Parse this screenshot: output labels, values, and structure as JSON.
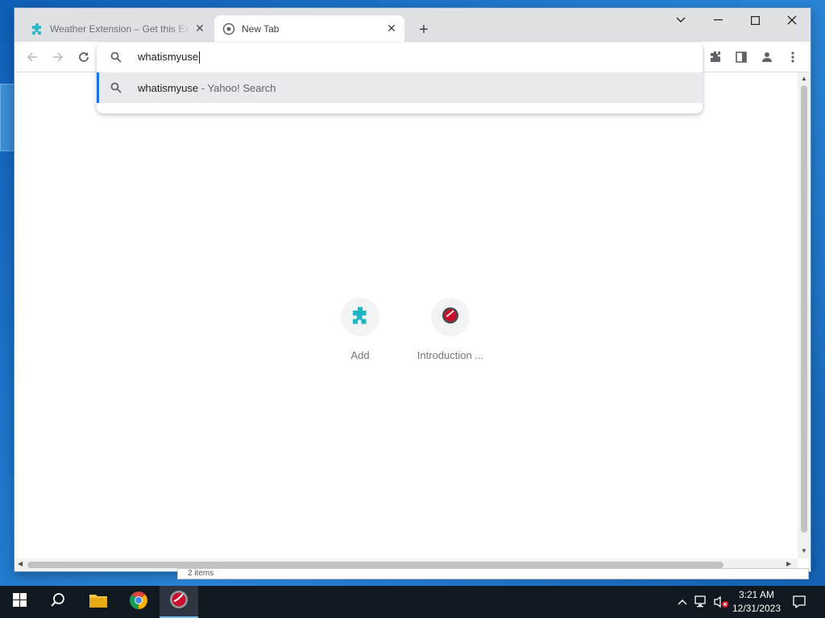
{
  "browser": {
    "tabs": [
      {
        "title": "Weather Extension – Get this Ex",
        "active": false,
        "icon": "puzzle-icon"
      },
      {
        "title": "New Tab",
        "active": true,
        "icon": "globe-icon"
      }
    ],
    "new_tab_symbol": "+",
    "close_symbol": "✕"
  },
  "omnibox": {
    "typed_text": "whatismyuse",
    "suggestion": {
      "query": "whatismyuse",
      "separator": " - ",
      "engine": "Yahoo! Search"
    }
  },
  "new_tab_page": {
    "shortcuts": [
      {
        "label": "Add",
        "icon": "puzzle-icon"
      },
      {
        "label": "Introduction ...",
        "icon": "red-disc-icon"
      }
    ]
  },
  "background_window": {
    "status_text": "2 items"
  },
  "taskbar": {
    "clock_time": "3:21 AM",
    "clock_date": "12/31/2023"
  },
  "colors": {
    "accent": "#1a73e8",
    "puzzle": "#1fb5c5",
    "taskbar": "#101820"
  }
}
